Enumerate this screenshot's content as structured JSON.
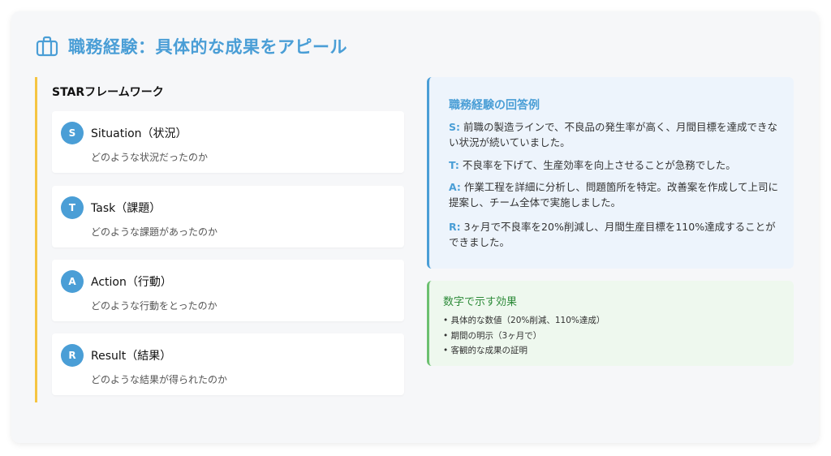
{
  "header": {
    "icon": "briefcase-icon",
    "title": "職務経験：具体的な成果をアピール",
    "accent_color": "#4a9ed6"
  },
  "star": {
    "heading": "STARフレームワーク",
    "accent_color": "#f5c542",
    "items": [
      {
        "letter": "S",
        "title": "Situation（状況）",
        "desc": "どのような状況だったのか"
      },
      {
        "letter": "T",
        "title": "Task（課題）",
        "desc": "どのような課題があったのか"
      },
      {
        "letter": "A",
        "title": "Action（行動）",
        "desc": "どのような行動をとったのか"
      },
      {
        "letter": "R",
        "title": "Result（結果）",
        "desc": "どのような結果が得られたのか"
      }
    ]
  },
  "example": {
    "heading": "職務経験の回答例",
    "lines": [
      {
        "key": "S:",
        "text": " 前職の製造ラインで、不良品の発生率が高く、月間目標を達成できない状況が続いていました。"
      },
      {
        "key": "T:",
        "text": " 不良率を下げて、生産効率を向上させることが急務でした。"
      },
      {
        "key": "A:",
        "text": " 作業工程を詳細に分析し、問題箇所を特定。改善案を作成して上司に提案し、チーム全体で実施しました。"
      },
      {
        "key": "R:",
        "text": " 3ヶ月で不良率を20%削減し、月間生産目標を110%達成することができました。"
      }
    ]
  },
  "effect": {
    "heading": "数字で示す効果",
    "accent_color": "#6cc070",
    "items": [
      "• 具体的な数値（20%削減、110%達成）",
      "• 期間の明示（3ヶ月で）",
      "• 客観的な成果の証明"
    ]
  }
}
